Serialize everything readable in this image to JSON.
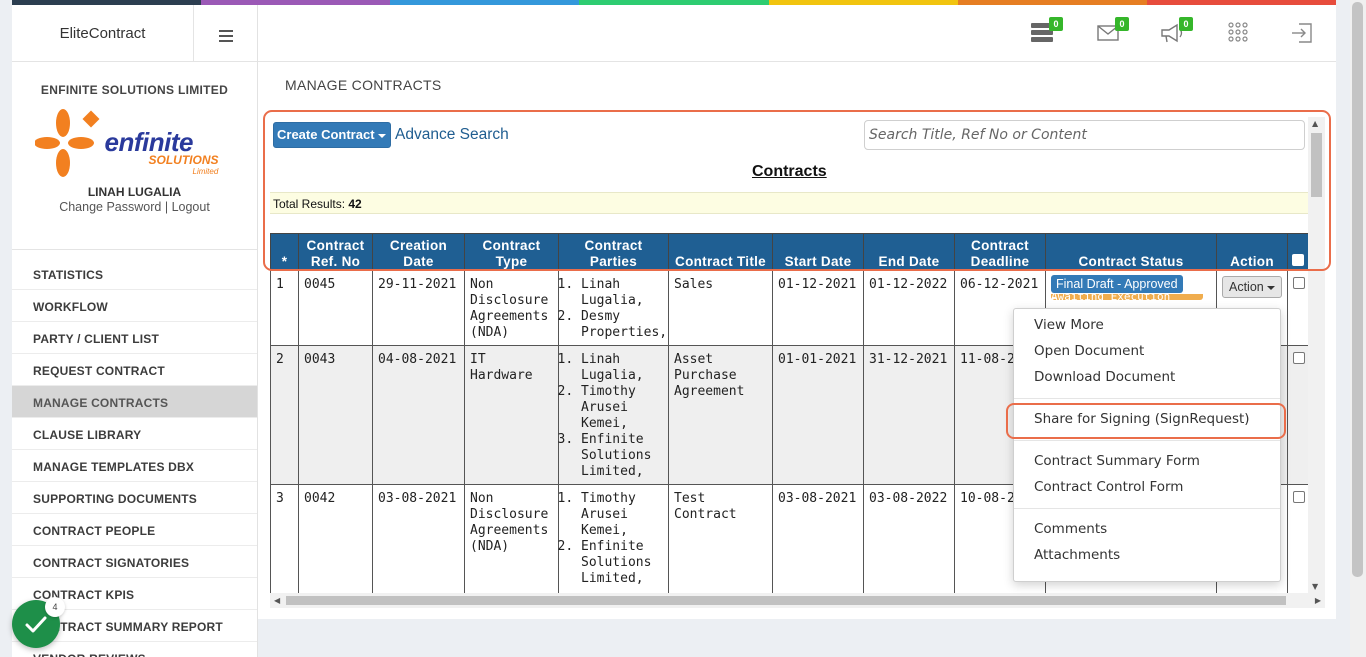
{
  "app": {
    "brand": "EliteContract"
  },
  "profile": {
    "company": "ENFINITE SOLUTIONS LIMITED",
    "logo_main": "enfinite",
    "logo_sub": "SOLUTIONS",
    "logo_small": "Limited",
    "user_name": "LINAH LUGALIA",
    "change_password": "Change Password",
    "separator": "|",
    "logout": "Logout"
  },
  "sidebar": {
    "items": [
      {
        "label": "STATISTICS"
      },
      {
        "label": "WORKFLOW"
      },
      {
        "label": "PARTY / CLIENT LIST"
      },
      {
        "label": "REQUEST CONTRACT"
      },
      {
        "label": "MANAGE CONTRACTS",
        "active": true
      },
      {
        "label": "CLAUSE LIBRARY"
      },
      {
        "label": "MANAGE TEMPLATES DBX"
      },
      {
        "label": "SUPPORTING DOCUMENTS"
      },
      {
        "label": "CONTRACT PEOPLE"
      },
      {
        "label": "CONTRACT SIGNATORIES"
      },
      {
        "label": "CONTRACT KPIS"
      },
      {
        "label": "CONTRACT SUMMARY REPORT"
      },
      {
        "label": "VENDOR REVIEWS"
      }
    ]
  },
  "topbar": {
    "icons": [
      {
        "name": "server-icon",
        "badge": "0"
      },
      {
        "name": "envelope-icon",
        "badge": "0"
      },
      {
        "name": "megaphone-icon",
        "badge": "0"
      },
      {
        "name": "apps-grid-icon"
      },
      {
        "name": "logout-icon"
      }
    ]
  },
  "page": {
    "title": "MANAGE CONTRACTS"
  },
  "toolbar": {
    "create_label": "Create Contract",
    "advance_search": "Advance Search",
    "search_placeholder": "Search Title, Ref No or Content"
  },
  "contracts": {
    "title": "Contracts",
    "total_label": "Total Results:",
    "total_value": "42",
    "columns": [
      "*",
      "Contract Ref. No",
      "Creation Date",
      "Contract Type",
      "Contract Parties",
      "Contract Title",
      "Start Date",
      "End Date",
      "Contract Deadline",
      "Contract Status",
      "Action"
    ],
    "rows": [
      {
        "num": "1",
        "ref": "0045",
        "created": "29-11-2021",
        "type": "Non Disclosure Agreements (NDA)",
        "parties": [
          "Linah Lugalia,",
          "Desmy Properties,"
        ],
        "title": "Sales",
        "start": "01-12-2021",
        "end": "01-12-2022",
        "deadline": "06-12-2021",
        "status": "Final Draft - Approved",
        "status2": "Awaiting Execution Form",
        "action": "Action"
      },
      {
        "num": "2",
        "ref": "0043",
        "created": "04-08-2021",
        "type": "IT Hardware",
        "parties": [
          "Linah Lugalia,",
          "Timothy Arusei Kemei,",
          "Enfinite Solutions Limited,"
        ],
        "title": "Asset Purchase Agreement",
        "start": "01-01-2021",
        "end": "31-12-2021",
        "deadline": "11-08-2",
        "status": "",
        "action": ""
      },
      {
        "num": "3",
        "ref": "0042",
        "created": "03-08-2021",
        "type": "Non Disclosure Agreements (NDA)",
        "parties": [
          "Timothy Arusei Kemei,",
          "Enfinite Solutions Limited,"
        ],
        "title": "Test Contract",
        "start": "03-08-2021",
        "end": "03-08-2022",
        "deadline": "10-08-2",
        "status": "",
        "action": ""
      }
    ]
  },
  "action_menu": {
    "groups": [
      [
        "View More",
        "Open Document",
        "Download Document"
      ],
      [
        "Share for Signing (SignRequest)"
      ],
      [
        "Contract Summary Form",
        "Contract Control Form"
      ],
      [
        "Comments",
        "Attachments"
      ]
    ]
  },
  "fab": {
    "count": "4"
  },
  "colors": {
    "header_blue": "#1f5f93",
    "button_blue": "#337ab7",
    "highlight": "#ea6d4a",
    "badge_green": "#35b62a",
    "fab_green": "#1e8f49",
    "colorbar": [
      "#2c3e50",
      "#9b59b6",
      "#3498db",
      "#2ecc71",
      "#f1c40f",
      "#e67e22",
      "#e74c3c"
    ]
  }
}
